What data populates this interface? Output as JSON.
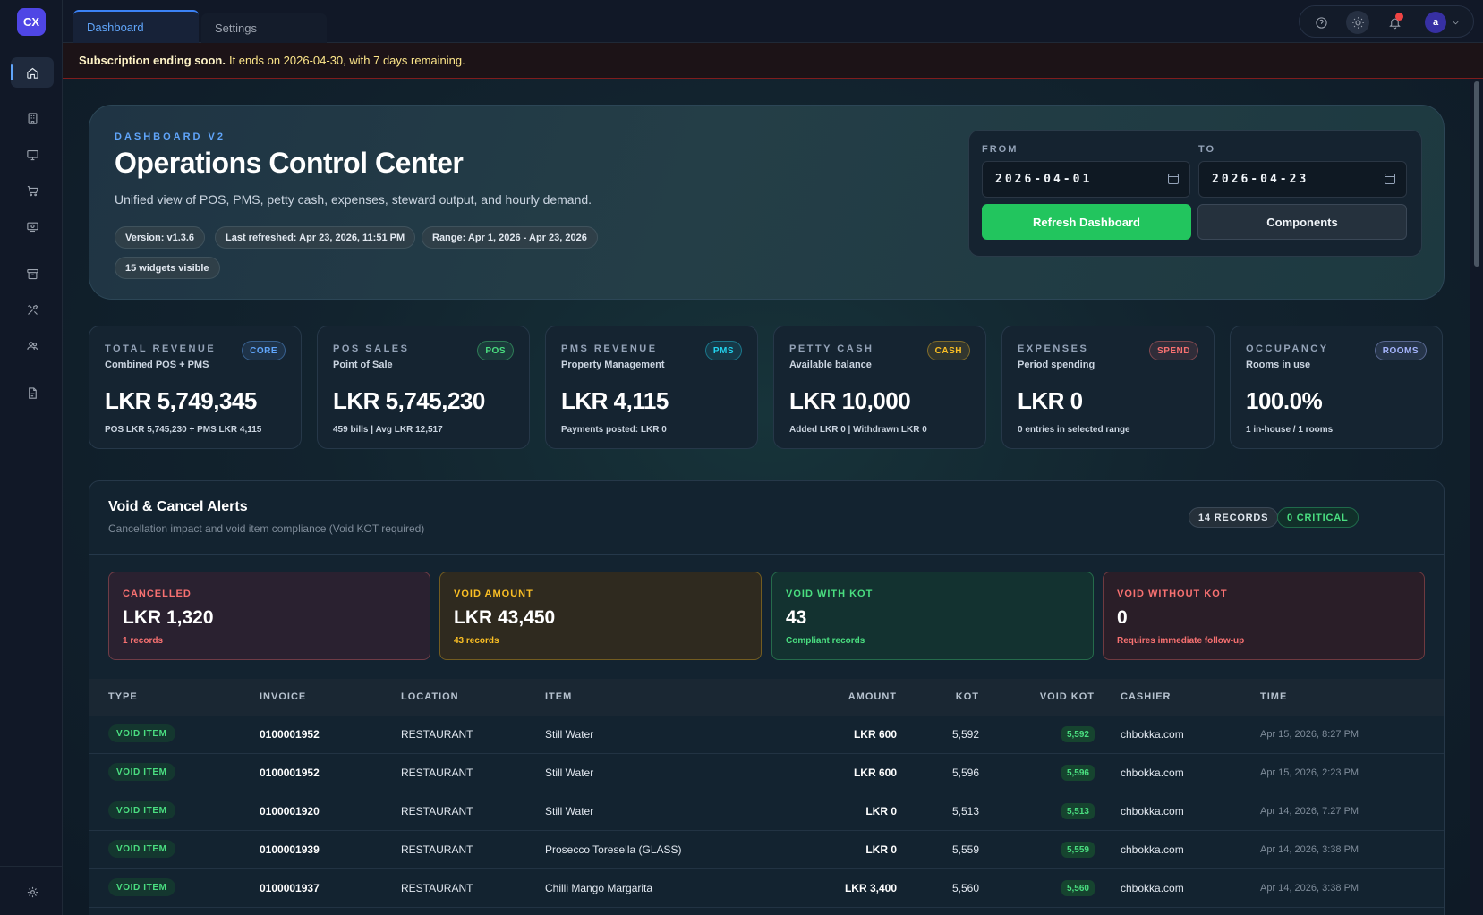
{
  "app": {
    "logo": "CX"
  },
  "tabs": [
    {
      "label": "Dashboard",
      "active": true
    },
    {
      "label": "Settings",
      "active": false
    }
  ],
  "sidebar": {
    "items": [
      {
        "icon": "home-icon",
        "active": true
      },
      {
        "icon": "building-icon"
      },
      {
        "icon": "monitor-icon"
      },
      {
        "icon": "cart-icon"
      },
      {
        "icon": "cash-register-icon"
      },
      {
        "icon": "archive-icon"
      },
      {
        "icon": "tools-icon"
      },
      {
        "icon": "users-icon"
      },
      {
        "icon": "report-icon"
      }
    ],
    "bottom_icon": "gear-icon"
  },
  "user": {
    "avatar_letter": "a"
  },
  "banner": {
    "bold": "Subscription ending soon.",
    "text": "It ends on 2026-04-30, with 7 days remaining."
  },
  "hero": {
    "kicker": "DASHBOARD V2",
    "title": "Operations Control Center",
    "description": "Unified view of POS, PMS, petty cash, expenses, steward output, and hourly demand.",
    "chips": [
      "Version: v1.3.6",
      "Last refreshed: Apr 23, 2026, 11:51 PM",
      "Range: Apr 1, 2026 - Apr 23, 2026",
      "15 widgets visible"
    ]
  },
  "date_range": {
    "from_label": "FROM",
    "from_value": "2026-04-01",
    "to_label": "TO",
    "to_value": "2026-04-23",
    "refresh_label": "Refresh Dashboard",
    "components_label": "Components"
  },
  "kpis": [
    {
      "title": "TOTAL REVENUE",
      "subtitle": "Combined POS + PMS",
      "badge": "CORE",
      "value": "LKR 5,749,345",
      "foot": "POS LKR 5,745,230 + PMS LKR 4,115",
      "badge_color": "#60a5fa"
    },
    {
      "title": "POS SALES",
      "subtitle": "Point of Sale",
      "badge": "POS",
      "value": "LKR 5,745,230",
      "foot": "459 bills | Avg LKR 12,517",
      "badge_color": "#4ade80"
    },
    {
      "title": "PMS REVENUE",
      "subtitle": "Property Management",
      "badge": "PMS",
      "value": "LKR 4,115",
      "foot": "Payments posted: LKR 0",
      "badge_color": "#22d3ee"
    },
    {
      "title": "PETTY CASH",
      "subtitle": "Available balance",
      "badge": "CASH",
      "value": "LKR 10,000",
      "foot": "Added LKR 0 | Withdrawn LKR 0",
      "badge_color": "#fbbf24"
    },
    {
      "title": "EXPENSES",
      "subtitle": "Period spending",
      "badge": "SPEND",
      "value": "LKR 0",
      "foot": "0 entries in selected range",
      "badge_color": "#f87171"
    },
    {
      "title": "OCCUPANCY",
      "subtitle": "Rooms in use",
      "badge": "ROOMS",
      "value": "100.0%",
      "foot": "1 in-house / 1 rooms",
      "badge_color": "#a5b4fc"
    }
  ],
  "void_panel": {
    "title": "Void & Cancel Alerts",
    "subtitle": "Cancellation impact and void item compliance (Void KOT required)",
    "records_pill": "14 RECORDS",
    "critical_pill": "0 CRITICAL",
    "stats": [
      {
        "title": "CANCELLED",
        "value": "LKR 1,320",
        "foot": "1 records",
        "color": "#f87171"
      },
      {
        "title": "VOID AMOUNT",
        "value": "LKR 43,450",
        "foot": "43 records",
        "color": "#fbbf24"
      },
      {
        "title": "VOID WITH KOT",
        "value": "43",
        "foot": "Compliant records",
        "color": "#4ade80"
      },
      {
        "title": "VOID WITHOUT KOT",
        "value": "0",
        "foot": "Requires immediate follow-up",
        "color": "#f87171"
      }
    ],
    "columns": [
      "TYPE",
      "INVOICE",
      "LOCATION",
      "ITEM",
      "AMOUNT",
      "KOT",
      "VOID KOT",
      "CASHIER",
      "TIME"
    ],
    "rows": [
      {
        "type": "VOID ITEM",
        "invoice": "0100001952",
        "location": "RESTAURANT",
        "item": "Still Water",
        "amount": "LKR 600",
        "kot": "5,592",
        "void_kot": "5,592",
        "cashier": "chbokka.com",
        "time": "Apr 15, 2026, 8:27 PM"
      },
      {
        "type": "VOID ITEM",
        "invoice": "0100001952",
        "location": "RESTAURANT",
        "item": "Still Water",
        "amount": "LKR 600",
        "kot": "5,596",
        "void_kot": "5,596",
        "cashier": "chbokka.com",
        "time": "Apr 15, 2026, 2:23 PM"
      },
      {
        "type": "VOID ITEM",
        "invoice": "0100001920",
        "location": "RESTAURANT",
        "item": "Still Water",
        "amount": "LKR 0",
        "kot": "5,513",
        "void_kot": "5,513",
        "cashier": "chbokka.com",
        "time": "Apr 14, 2026, 7:27 PM"
      },
      {
        "type": "VOID ITEM",
        "invoice": "0100001939",
        "location": "RESTAURANT",
        "item": "Prosecco Toresella (GLASS)",
        "amount": "LKR 0",
        "kot": "5,559",
        "void_kot": "5,559",
        "cashier": "chbokka.com",
        "time": "Apr 14, 2026, 3:38 PM"
      },
      {
        "type": "VOID ITEM",
        "invoice": "0100001937",
        "location": "RESTAURANT",
        "item": "Chilli Mango Margarita",
        "amount": "LKR 3,400",
        "kot": "5,560",
        "void_kot": "5,560",
        "cashier": "chbokka.com",
        "time": "Apr 14, 2026, 3:38 PM"
      }
    ]
  }
}
